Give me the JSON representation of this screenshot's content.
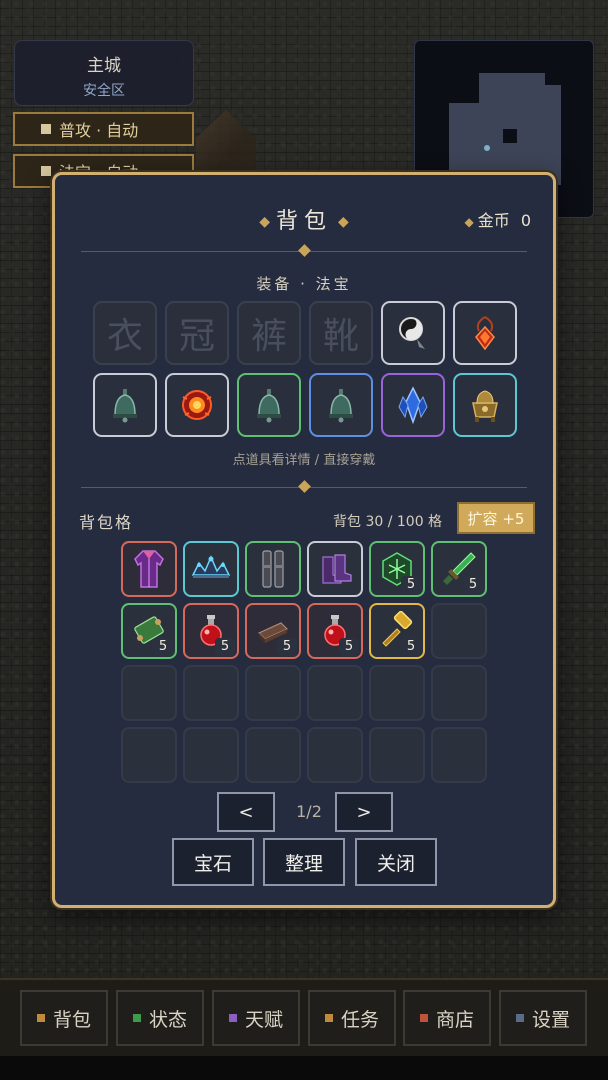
{
  "zone": {
    "name": "主城",
    "sub": "安全区"
  },
  "modes": [
    {
      "label": "普攻 · 自动"
    },
    {
      "label": "法宝 · 自动"
    }
  ],
  "panel": {
    "title": "背包",
    "gold_label": "金币",
    "gold_value": "0",
    "equip_title": "装备 · 法宝",
    "equip_slots_empty": [
      "衣",
      "冠",
      "裤",
      "靴"
    ],
    "hint": "点道具看详情 / 直接穿戴",
    "bag_title": "背包格",
    "bag_count": "背包 30 / 100 格",
    "expand_label": "扩容 +5",
    "pager": {
      "prev": "<",
      "next": ">",
      "page": "1/2"
    },
    "actions": [
      "宝石",
      "整理",
      "关闭"
    ]
  },
  "equipped": [
    {
      "icon": "yin-yang-charm-icon",
      "rarity": "white"
    },
    {
      "icon": "red-pendant-icon",
      "rarity": "white"
    },
    {
      "icon": "bell-icon",
      "rarity": "white"
    },
    {
      "icon": "fire-orb-icon",
      "rarity": "white"
    },
    {
      "icon": "bell-icon",
      "rarity": "green"
    },
    {
      "icon": "bell-icon",
      "rarity": "blue"
    },
    {
      "icon": "blue-crystal-icon",
      "rarity": "purple"
    },
    {
      "icon": "treasure-cauldron-icon",
      "rarity": "cyan"
    }
  ],
  "bag_items": [
    {
      "icon": "purple-robe-icon",
      "rarity": "red",
      "qty": ""
    },
    {
      "icon": "crown-icon",
      "rarity": "cyan",
      "qty": ""
    },
    {
      "icon": "leg-armor-icon",
      "rarity": "green",
      "qty": ""
    },
    {
      "icon": "boots-icon",
      "rarity": "white",
      "qty": ""
    },
    {
      "icon": "green-rune-icon",
      "rarity": "green",
      "qty": "5"
    },
    {
      "icon": "green-dagger-icon",
      "rarity": "green",
      "qty": "5"
    },
    {
      "icon": "scroll-icon",
      "rarity": "green",
      "qty": "5"
    },
    {
      "icon": "red-potion-icon",
      "rarity": "red",
      "qty": "5"
    },
    {
      "icon": "whetstone-icon",
      "rarity": "red",
      "qty": "5"
    },
    {
      "icon": "red-potion-icon",
      "rarity": "red",
      "qty": "5"
    },
    {
      "icon": "golden-hammer-icon",
      "rarity": "gold",
      "qty": "5"
    }
  ],
  "nav": [
    {
      "label": "背包",
      "color": "#c08a3e"
    },
    {
      "label": "状态",
      "color": "#3f9a4a"
    },
    {
      "label": "天赋",
      "color": "#8a5fc0"
    },
    {
      "label": "任务",
      "color": "#c08a3e"
    },
    {
      "label": "商店",
      "color": "#c0533e"
    },
    {
      "label": "设置",
      "color": "#5a6a8a"
    }
  ]
}
